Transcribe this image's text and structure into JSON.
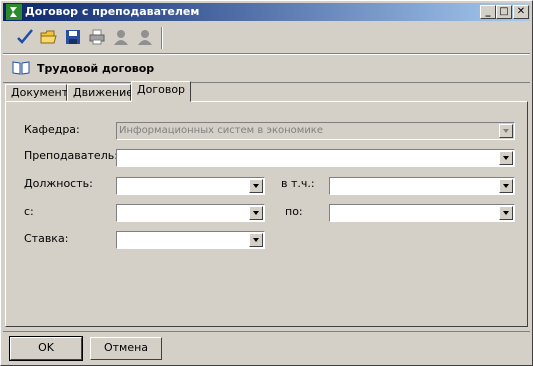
{
  "window": {
    "title": "Договор с преподавателем"
  },
  "toolbar": {
    "icons": [
      "check-icon",
      "open-folder-icon",
      "save-icon",
      "print-icon",
      "person-icon",
      "person-icon"
    ]
  },
  "header": {
    "title": "Трудовой договор"
  },
  "tabs": [
    {
      "label": "Документ"
    },
    {
      "label": "Движение"
    },
    {
      "label": "Договор",
      "active": true
    }
  ],
  "form": {
    "department": {
      "label": "Кафедра:",
      "value": "Информационных систем в экономике",
      "disabled": true
    },
    "teacher": {
      "label": "Преподаватель:",
      "value": ""
    },
    "position": {
      "label": "Должность:",
      "value": ""
    },
    "including": {
      "label": "в т.ч.:",
      "value": ""
    },
    "from": {
      "label": "с:",
      "value": ""
    },
    "to": {
      "label": "по:",
      "value": ""
    },
    "rate": {
      "label": "Ставка:",
      "value": ""
    }
  },
  "buttons": {
    "ok": "OK",
    "cancel": "Отмена"
  }
}
